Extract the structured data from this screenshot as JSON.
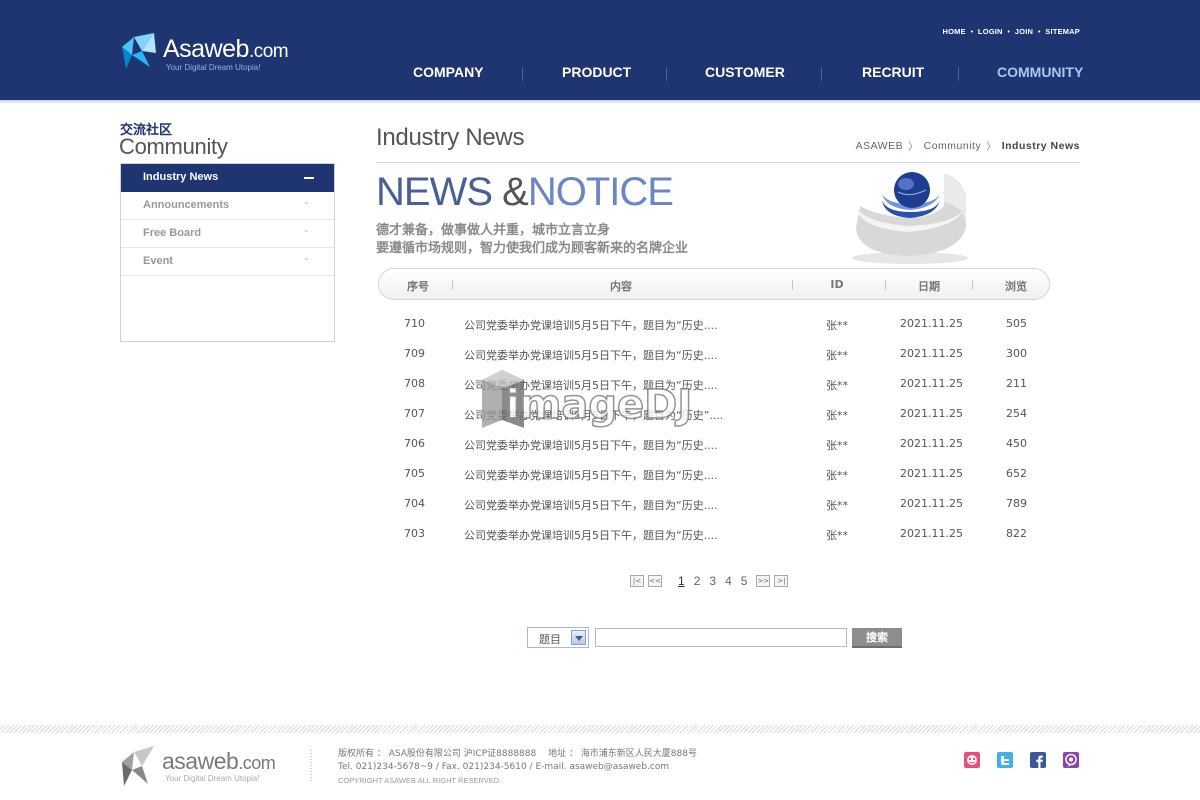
{
  "header": {
    "logo": {
      "name": "Asaweb",
      "suffix": ".com",
      "slogan": "Your Digital Dream Utopia!"
    },
    "util_links": [
      "HOME",
      "LOGIN",
      "JOIN",
      "SITEMAP"
    ],
    "nav": [
      {
        "label": "COMPANY",
        "active": false
      },
      {
        "label": "PRODUCT",
        "active": false
      },
      {
        "label": "CUSTOMER",
        "active": false
      },
      {
        "label": "RECRUIT",
        "active": false
      },
      {
        "label": "COMMUNITY",
        "active": true
      }
    ]
  },
  "sidebar": {
    "title_kor": "交流社区",
    "title_eng": "Community",
    "items": [
      {
        "label": "Industry News",
        "active": true
      },
      {
        "label": "Announcements",
        "active": false
      },
      {
        "label": "Free Board",
        "active": false
      },
      {
        "label": "Event",
        "active": false
      }
    ]
  },
  "content": {
    "page_title": "Industry News",
    "breadcrumb": [
      "ASAWEB",
      "Community",
      "Industry News"
    ],
    "banner": {
      "title_part1": "NEWS ",
      "title_part2": "&",
      "title_part3": "NOTICE",
      "sub1": "德才兼备，做事做人并重，城市立言立身",
      "sub2": "要遵循市场规则，智力使我们成为顾客新来的名牌企业"
    },
    "table": {
      "headers": [
        "序号",
        "内容",
        "ID",
        "日期",
        "浏览"
      ],
      "rows": [
        {
          "num": "710",
          "subject": "公司党委举办党课培训5月5日下午，题目为“历史....",
          "writer": "张**",
          "date": "2021.11.25",
          "views": "505"
        },
        {
          "num": "709",
          "subject": "公司党委举办党课培训5月5日下午，题目为“历史....",
          "writer": "张**",
          "date": "2021.11.25",
          "views": "300"
        },
        {
          "num": "708",
          "subject": "公司党委举办党课培训5月5日下午，题目为“历史....",
          "writer": "张**",
          "date": "2021.11.25",
          "views": "211"
        },
        {
          "num": "707",
          "subject": "公司党委举办党课培训5月5日下午，题目为“历史”....",
          "writer": "张**",
          "date": "2021.11.25",
          "views": "254"
        },
        {
          "num": "706",
          "subject": "公司党委举办党课培训5月5日下午，题目为“历史....",
          "writer": "张**",
          "date": "2021.11.25",
          "views": "450"
        },
        {
          "num": "705",
          "subject": "公司党委举办党课培训5月5日下午，题目为“历史....",
          "writer": "张**",
          "date": "2021.11.25",
          "views": "652"
        },
        {
          "num": "704",
          "subject": "公司党委举办党课培训5月5日下午，题目为“历史....",
          "writer": "张**",
          "date": "2021.11.25",
          "views": "789"
        },
        {
          "num": "703",
          "subject": "公司党委举办党课培训5月5日下午，题目为“历史....",
          "writer": "张**",
          "date": "2021.11.25",
          "views": "822"
        }
      ]
    },
    "pagination": {
      "pages": [
        "1",
        "2",
        "3",
        "4",
        "5"
      ],
      "current": "1"
    },
    "search": {
      "selected": "题目",
      "button": "搜索"
    },
    "watermark": "imageDJ"
  },
  "footer": {
    "logo": {
      "name": "asaweb",
      "suffix": ".com",
      "slogan": "Your Digital Dream Utopia!"
    },
    "line1": "版权所有 ： ASA股份有限公司 沪ICP证8888888  　地址 ： 海市浦东新区人民大厦888号",
    "line2": "Tel. 021)234-5678~9  / Fax. 021)234-5610  / E-mail. asaweb@asaweb.com",
    "line3": "COPYRIGHT ASAWEB ALL RIGHT RESERVED.",
    "sns": [
      "blog-icon",
      "twitter-icon",
      "facebook-icon",
      "me2day-icon"
    ]
  },
  "colors": {
    "primary": "#1f3571",
    "nav_active": "#a9c6f2",
    "banner_blue": "#4a5f96"
  }
}
